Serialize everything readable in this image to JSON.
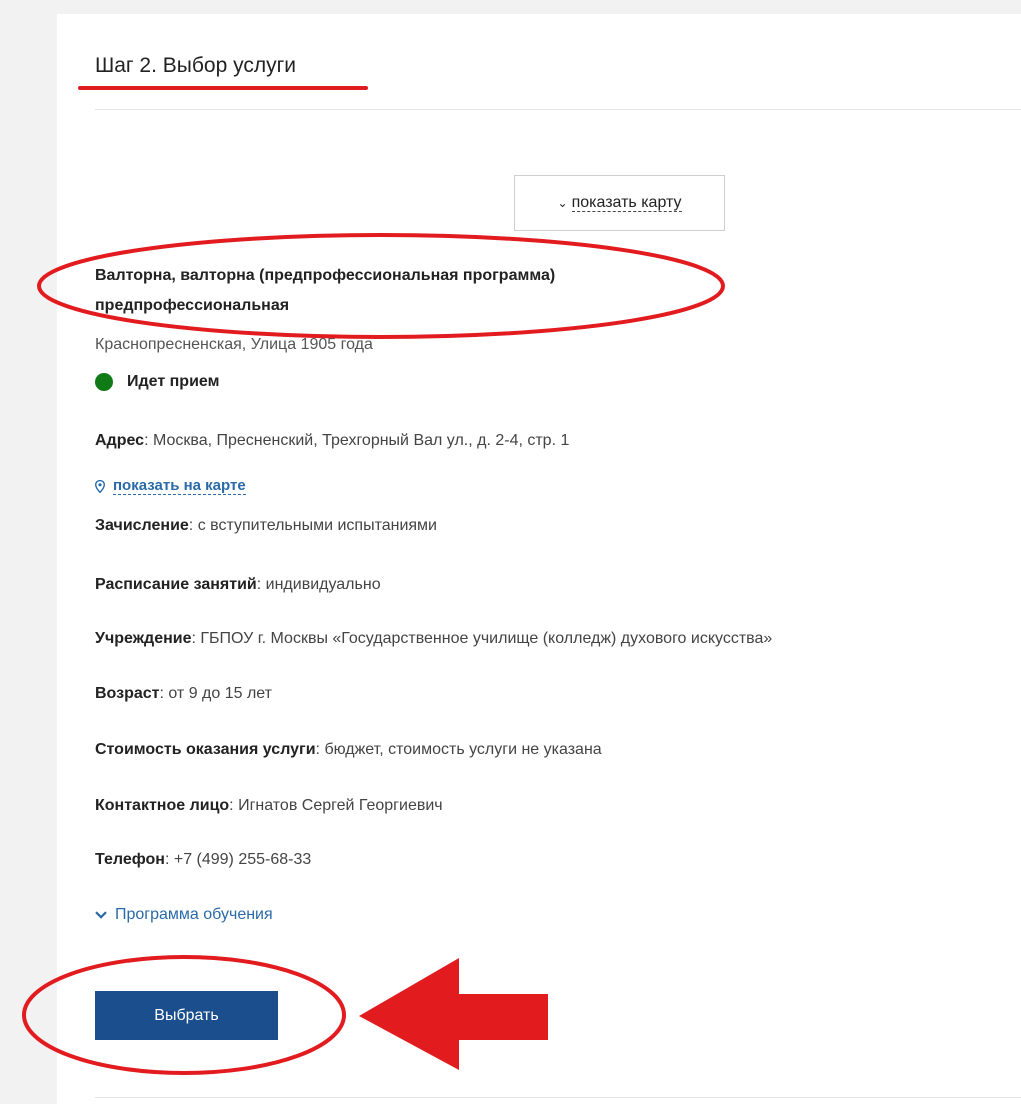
{
  "step": {
    "title": "Шаг 2. Выбор услуги"
  },
  "map_toggle": {
    "icon": "chevron-down-icon",
    "label": "показать карту"
  },
  "service": {
    "title": "Валторна, валторна (предпрофессиональная программа) предпрофессиональная",
    "district": "Краснопресненская, Улица 1905 года",
    "status": "Идет прием",
    "status_color": "#0f7a16"
  },
  "details": {
    "address": {
      "label": "Адрес",
      "value": ": Москва, Пресненский, Трехгорный Вал ул., д. 2-4, стр. 1"
    },
    "map_link": {
      "icon": "map-pin-icon",
      "label": "показать на карте"
    },
    "enrollment": {
      "label": "Зачисление",
      "value": ": с вступительными испытаниями"
    },
    "schedule": {
      "label": "Расписание занятий",
      "value": ": индивидуально"
    },
    "institution": {
      "label": "Учреждение",
      "value": ": ГБПОУ г. Москвы «Государственное училище (колледж) духового искусства»"
    },
    "age": {
      "label": "Возраст",
      "value": ": от 9 до 15 лет"
    },
    "cost": {
      "label": "Стоимость оказания услуги",
      "value": ": бюджет, стоимость услуги не указана"
    },
    "contact": {
      "label": "Контактное лицо",
      "value": ": Игнатов Сергей Георгиевич"
    },
    "phone": {
      "label": "Телефон",
      "value": ": +7 (499) 255-68-33"
    }
  },
  "program_toggle": {
    "icon": "chevron-down-icon",
    "label": "Программа обучения"
  },
  "select_button": {
    "label": "Выбрать"
  },
  "colors": {
    "accent_blue": "#1b4e8d",
    "link_blue": "#2a6aa8",
    "annotation_red": "#e21b1f"
  }
}
